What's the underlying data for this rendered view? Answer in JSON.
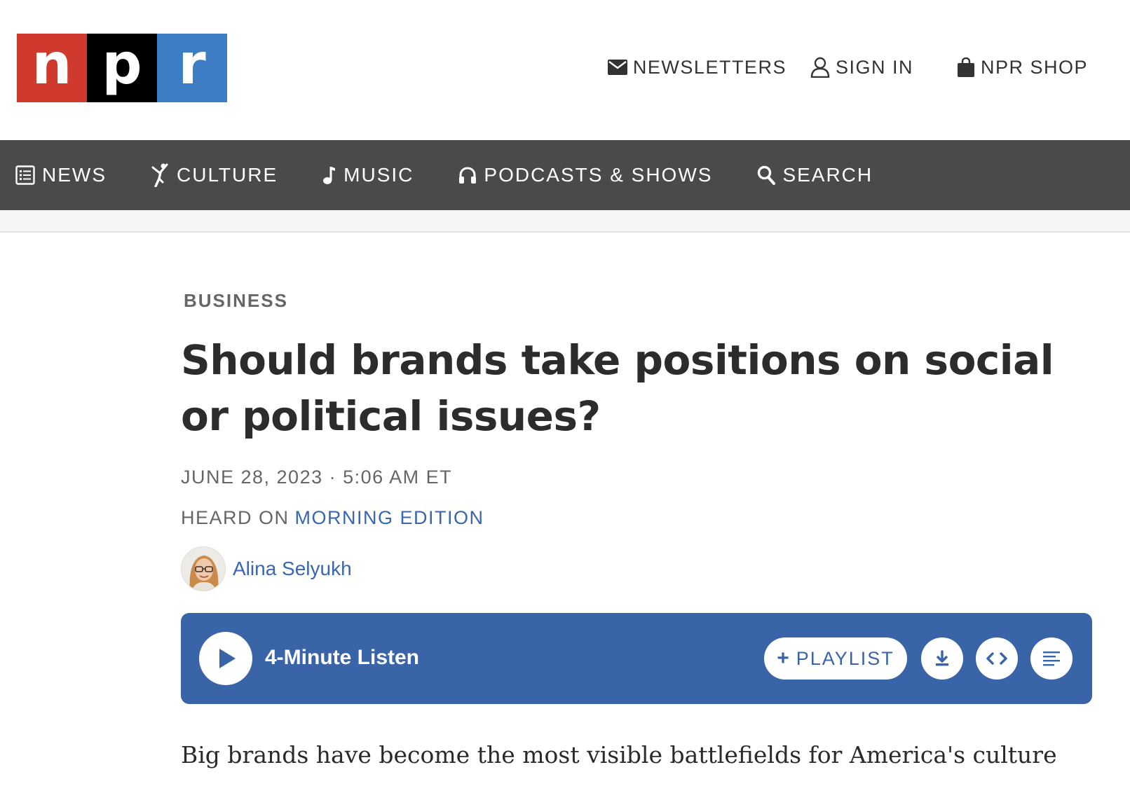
{
  "logo": {
    "letters": [
      "n",
      "p",
      "r"
    ],
    "colors": [
      "#d03a2e",
      "#000000",
      "#3d7dc3"
    ]
  },
  "top_links": {
    "newsletters": {
      "label": "NEWSLETTERS",
      "icon": "envelope-icon"
    },
    "sign_in": {
      "label": "SIGN IN",
      "icon": "user-icon"
    },
    "shop": {
      "label": "NPR SHOP",
      "icon": "shopping-bag-icon"
    }
  },
  "nav": {
    "news": {
      "label": "NEWS",
      "icon": "newspaper-icon"
    },
    "culture": {
      "label": "CULTURE",
      "icon": "dancer-icon"
    },
    "music": {
      "label": "MUSIC",
      "icon": "music-note-icon"
    },
    "podcasts": {
      "label": "PODCASTS & SHOWS",
      "icon": "headphones-icon"
    },
    "search": {
      "label": "SEARCH",
      "icon": "search-icon"
    }
  },
  "article": {
    "section": "BUSINESS",
    "headline": "Should brands take positions on social or political issues?",
    "dateline": "JUNE 28, 2023 · 5:06 AM ET",
    "heard_on_prefix": "HEARD ON",
    "heard_on_show": "MORNING EDITION",
    "author": "Alina Selyukh",
    "body_first_line": "Big brands have become the most visible battlefields for America's culture"
  },
  "player": {
    "listen_label": "4-Minute Listen",
    "playlist_label": "PLAYLIST",
    "accent": "#3a64a8"
  }
}
